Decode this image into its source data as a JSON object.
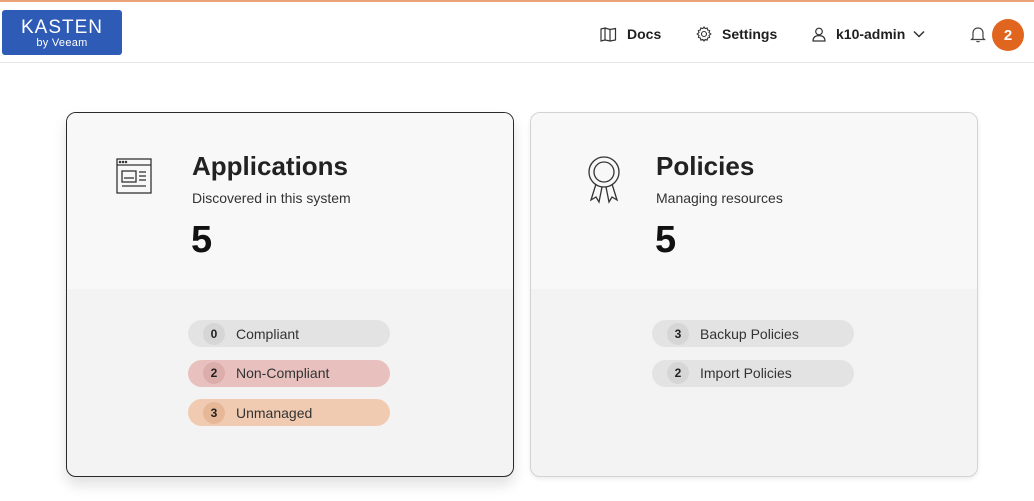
{
  "header": {
    "logo_line1": "KASTEN",
    "logo_line2": "by Veeam",
    "docs_label": "Docs",
    "settings_label": "Settings",
    "user_label": "k10-admin",
    "notification_count": "2"
  },
  "applications": {
    "title": "Applications",
    "subtitle": "Discovered in this system",
    "count": "5",
    "pills": [
      {
        "count": "0",
        "label": "Compliant"
      },
      {
        "count": "2",
        "label": "Non-Compliant"
      },
      {
        "count": "3",
        "label": "Unmanaged"
      }
    ]
  },
  "policies": {
    "title": "Policies",
    "subtitle": "Managing resources",
    "count": "5",
    "pills": [
      {
        "count": "3",
        "label": "Backup Policies"
      },
      {
        "count": "2",
        "label": "Import Policies"
      }
    ]
  },
  "icons": {
    "docs": "book-icon",
    "settings": "gear-icon",
    "user": "user-icon",
    "user_menu": "chevron-down-icon",
    "notifications": "bell-icon",
    "applications": "browser-window-icon",
    "policies": "award-ribbon-icon"
  },
  "colors": {
    "brand": "#2d5bb5",
    "badge": "#e0661f",
    "non_compliant": "#e8c1bf",
    "unmanaged": "#f1cbb1",
    "neutral_pill": "#e3e3e3"
  }
}
